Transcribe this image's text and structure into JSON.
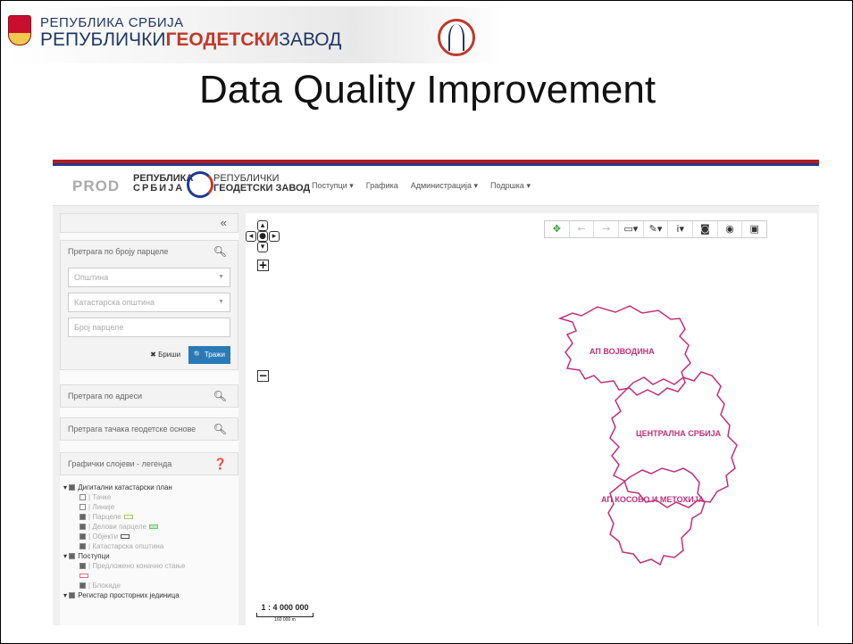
{
  "header": {
    "org_line1": "РЕПУБЛИКА СРБИЈА",
    "org_line2_a": "РЕПУБЛИЧКИ",
    "org_line2_b": "ГЕОДЕТСКИ",
    "org_line2_c": "ЗАВОД"
  },
  "slide_title": "Data Quality Improvement",
  "app": {
    "env": "PROD",
    "brand_left_1": "РЕПУБЛИКА",
    "brand_left_2": "СРБИЈА",
    "brand_right_1": "РЕПУБЛИЧКИ",
    "brand_right_2": "ГЕОДЕТСКИ ЗАВОД",
    "nav": [
      "Поступци ▾",
      "Графика",
      "Администрација ▾",
      "Подршка ▾"
    ],
    "collapse_label": "«",
    "parcel_search": {
      "title": "Претрага по броју парцеле",
      "municipality_placeholder": "Општина",
      "cadastral_placeholder": "Катастарска општина",
      "parcel_placeholder": "Број парцеле",
      "clear_label": "✖ Бриши",
      "search_label": "🔍 Тражи"
    },
    "address_search": {
      "title": "Претрага по адреси"
    },
    "point_search": {
      "title": "Претрага тачака геодетске основе"
    },
    "legend": {
      "title": "Графички слојеви - легенда",
      "rows": [
        {
          "level": 1,
          "label": "Дигитални катастарски план",
          "checked": true
        },
        {
          "level": 2,
          "label": "Тачке",
          "checked": false
        },
        {
          "level": 2,
          "label": "Линије",
          "checked": false
        },
        {
          "level": 2,
          "label": "Парцеле",
          "checked": true
        },
        {
          "level": 2,
          "label": "Делови парцеле",
          "checked": true
        },
        {
          "level": 2,
          "label": "Објекти",
          "checked": true
        },
        {
          "level": 2,
          "label": "Катастарска општина",
          "checked": true
        },
        {
          "level": 1,
          "label": "Поступци",
          "checked": true
        },
        {
          "level": 2,
          "label": "Предложено коначно стање",
          "checked": true
        },
        {
          "level": 2,
          "label": "Блокаде",
          "checked": true
        },
        {
          "level": 1,
          "label": "Регистар просторних јединица",
          "checked": true
        }
      ]
    },
    "map": {
      "labels": {
        "vojvodina": "АП ВОЈВОДИНА",
        "central": "ЦЕНТРАЛНА СРБИЈА",
        "kosovo": "АП КОСОВО И МЕТОХИЈА"
      },
      "scale_text": "1 : 4 000 000",
      "scale_sub": "160 000 m",
      "boundary_color": "#c0307a"
    }
  }
}
